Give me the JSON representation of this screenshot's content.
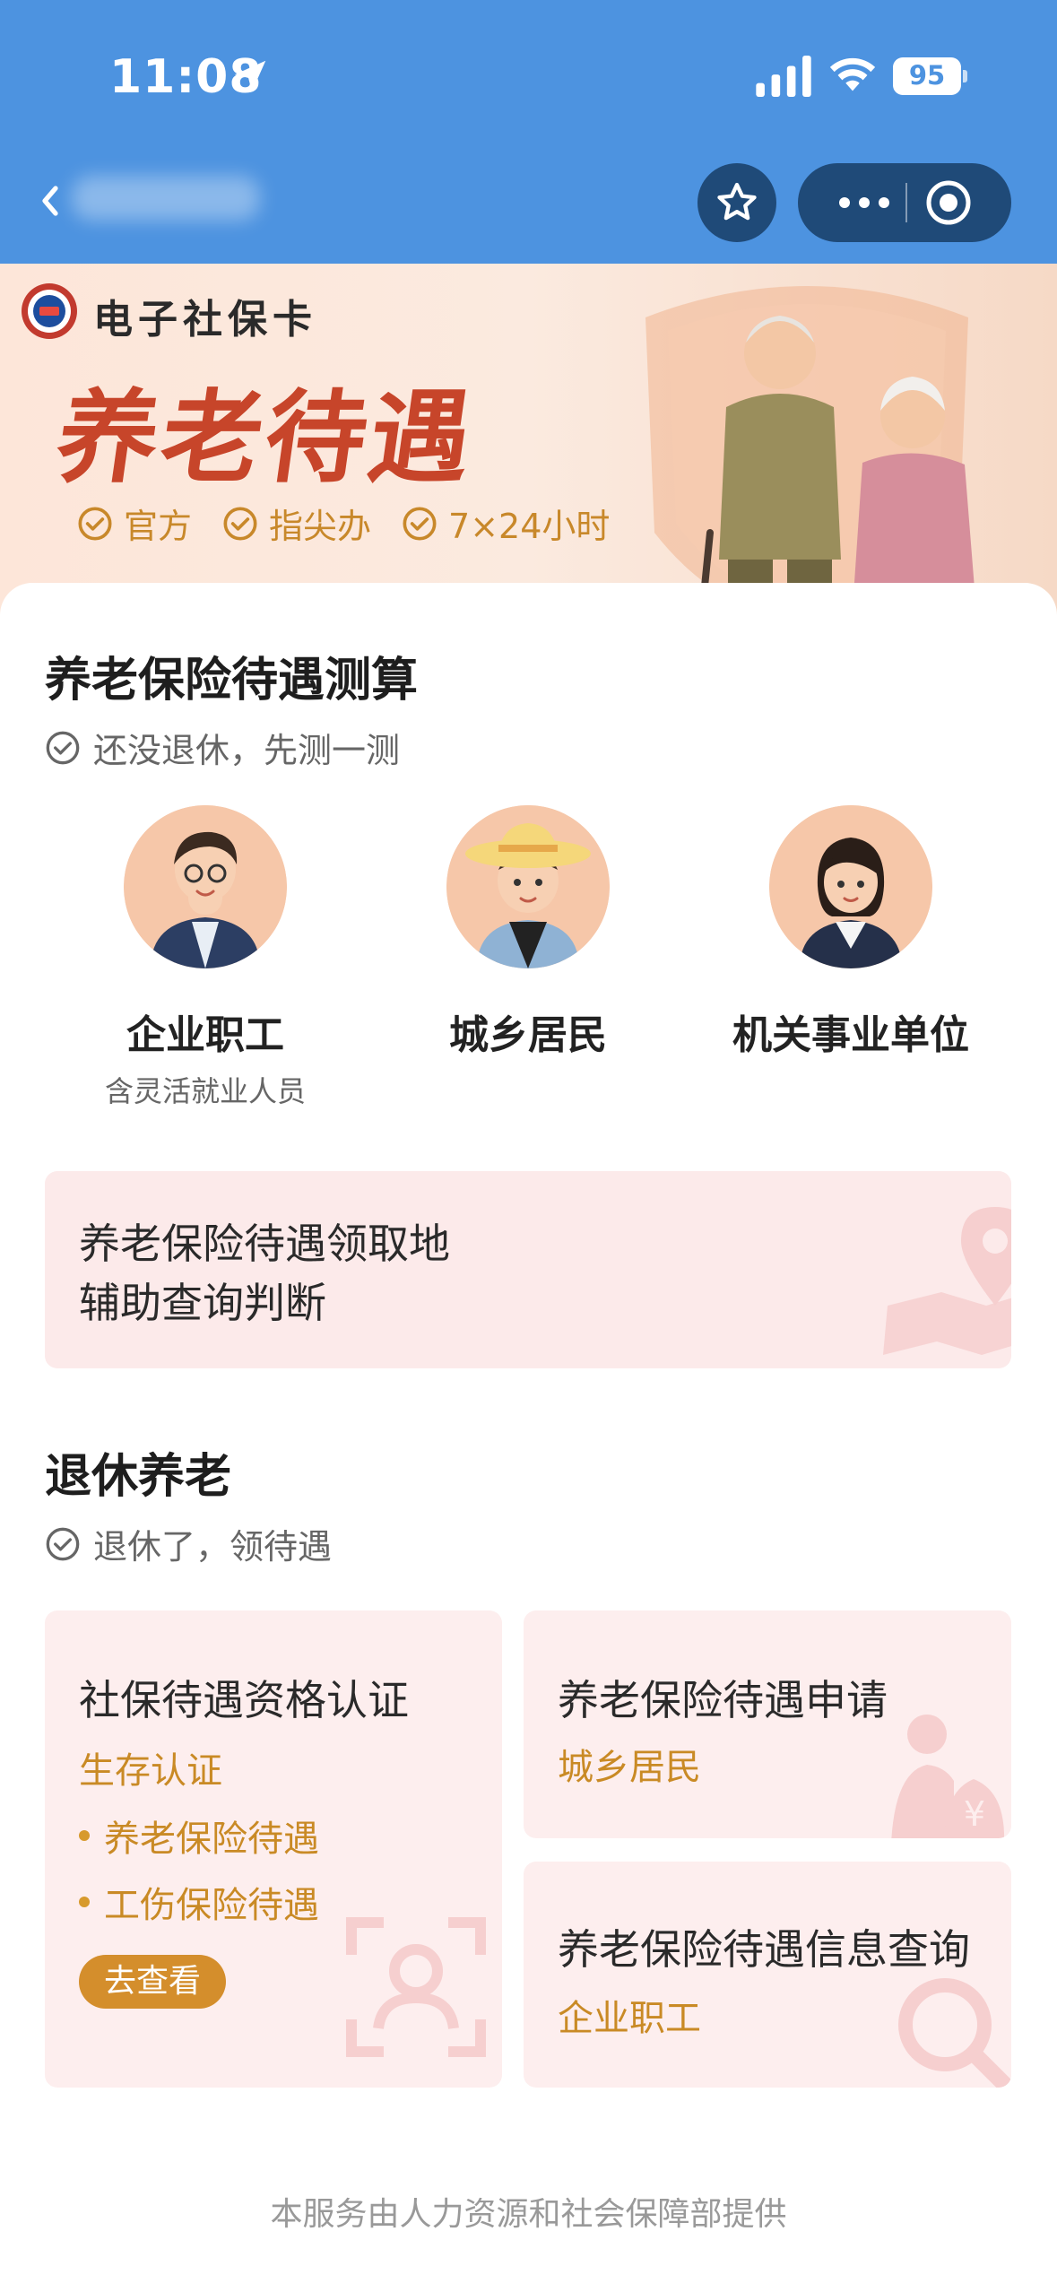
{
  "status_bar": {
    "time": "11:08",
    "battery": "95",
    "icons": [
      "location-arrow-icon",
      "signal-icon",
      "wifi-icon",
      "battery-icon"
    ]
  },
  "nav": {
    "title_blurred": "",
    "icons": [
      "back-chevron-icon",
      "star-icon",
      "more-icon",
      "close-circle-icon"
    ]
  },
  "banner": {
    "brand": "电子社保卡",
    "title": "养老待遇",
    "tags": [
      "官方",
      "指尖办",
      "7×24小时"
    ]
  },
  "estimate": {
    "title": "养老保险待遇测算",
    "subtitle": "还没退休，先测一测",
    "personas": [
      {
        "name": "企业职工",
        "note": "含灵活就业人员"
      },
      {
        "name": "城乡居民",
        "note": ""
      },
      {
        "name": "机关事业单位",
        "note": ""
      }
    ]
  },
  "locate_card": {
    "line1": "养老保险待遇领取地",
    "line2": "辅助查询判断"
  },
  "retire": {
    "title": "退休养老",
    "subtitle": "退休了，领待遇",
    "cards": {
      "certification": {
        "title": "社保待遇资格认证",
        "subtitle": "生存认证",
        "bullets": [
          "养老保险待遇",
          "工伤保险待遇"
        ],
        "button": "去查看"
      },
      "apply": {
        "title": "养老保险待遇申请",
        "subtitle": "城乡居民"
      },
      "query": {
        "title": "养老保险待遇信息查询",
        "subtitle": "企业职工"
      }
    }
  },
  "footer": "本服务由人力资源和社会保障部提供",
  "colors": {
    "top_bar": "#4d93e0",
    "capsule": "#1f4a78",
    "banner_title": "#c7452a",
    "accent_gold": "#c98a25",
    "card_bg": "#fdeeee"
  }
}
